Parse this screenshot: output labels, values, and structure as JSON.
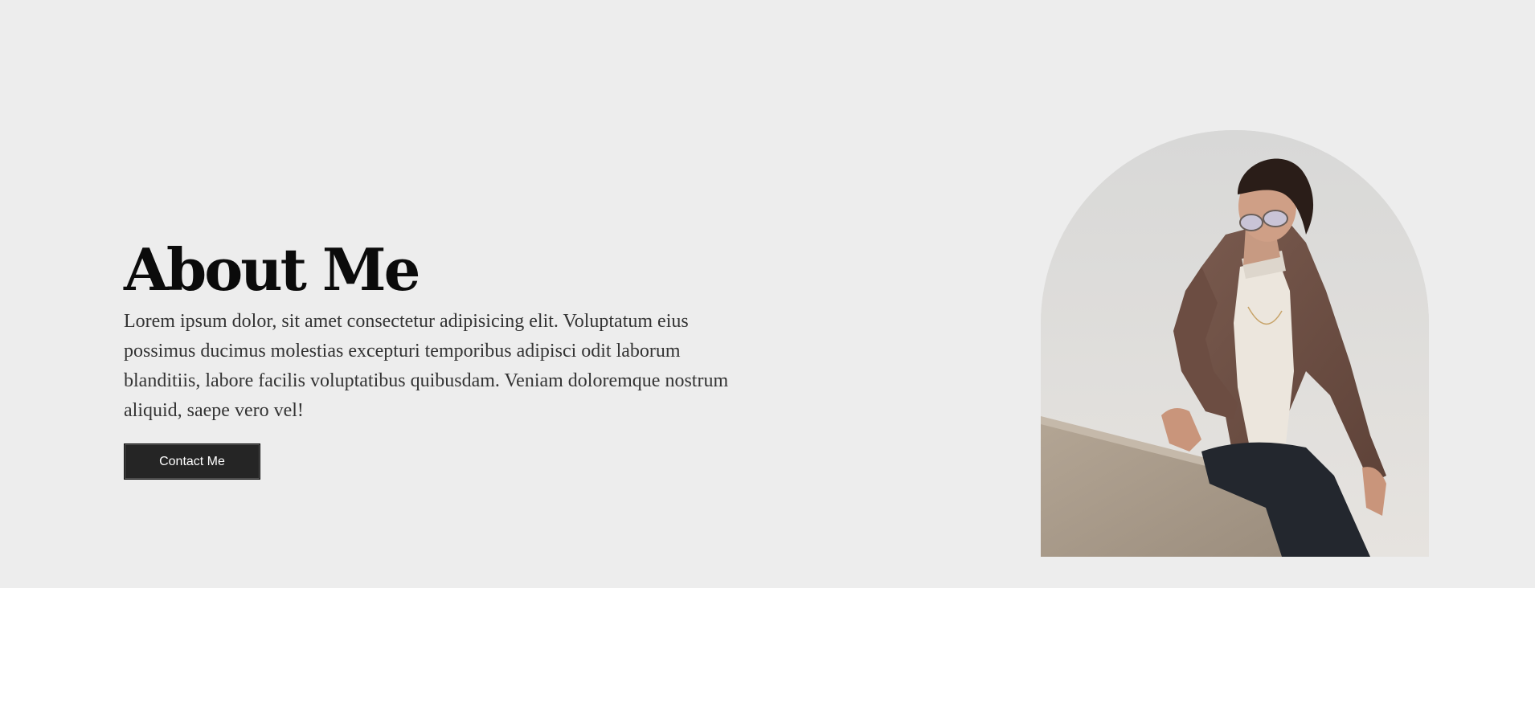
{
  "about": {
    "title": "About Me",
    "description": "Lorem ipsum dolor, sit amet consectetur adipisicing elit. Voluptatum eius possimus ducimus molestias excepturi temporibus adipisci odit laborum blanditiis, labore facilis voluptatibus quibusdam. Veniam doloremque nostrum aliquid, saepe vero vel!",
    "contact_label": "Contact Me"
  },
  "colors": {
    "hero_background": "#ededed",
    "page_background": "#ffffff",
    "button_background": "#252525",
    "button_text": "#ffffff",
    "heading_text": "#0b0b0b",
    "body_text": "#333333"
  },
  "portrait": {
    "subject": "man in glasses and brown jacket sitting on a concrete ledge"
  }
}
